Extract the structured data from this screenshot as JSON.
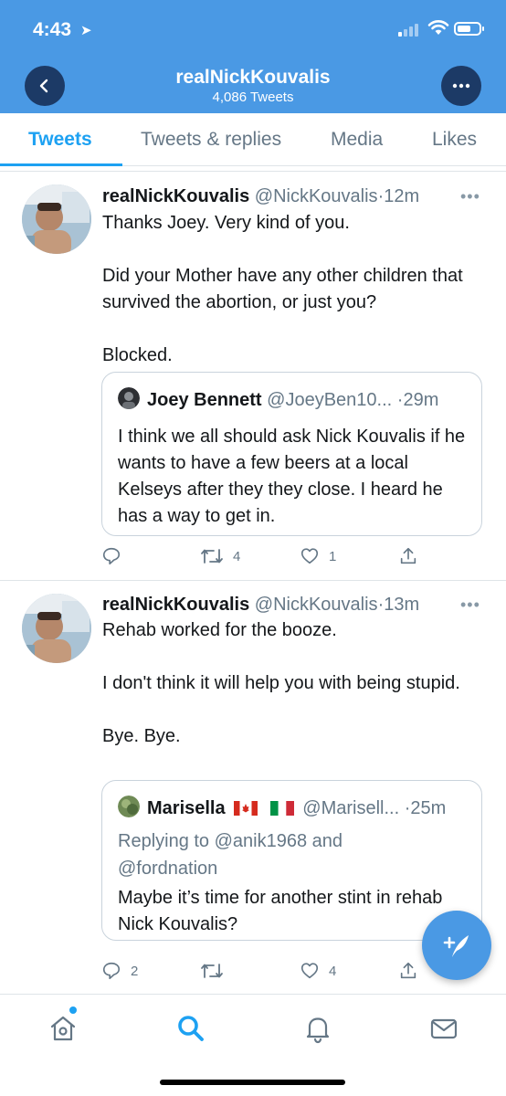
{
  "status_bar": {
    "time": "4:43"
  },
  "header": {
    "name": "realNickKouvalis",
    "tweet_count": "4,086 Tweets",
    "back_icon": "chevron-left-icon",
    "more_icon": "more-horizontal-icon",
    "background": "#4a99e4"
  },
  "tabs": [
    {
      "label": "Tweets",
      "active": true
    },
    {
      "label": "Tweets & replies",
      "active": false
    },
    {
      "label": "Media",
      "active": false
    },
    {
      "label": "Likes",
      "active": false
    }
  ],
  "tweets": [
    {
      "name": "realNickKouvalis",
      "handle": "@NickKouvalis",
      "separator": "·",
      "time": "12m",
      "caret": "•••",
      "text": "Thanks Joey. Very kind of you.\n\nDid your Mother have any other children that survived the abortion, or just you?\n\nBlocked.",
      "quote": {
        "name": "Joey Bennett",
        "handle": "@JoeyBen10...",
        "separator": "·",
        "time": "29m",
        "text": "I think we all should ask Nick Kouvalis if he wants to have a few beers at a local Kelseys after they they close. I heard he has a way to get in."
      },
      "actions": {
        "replies": "",
        "retweets": "4",
        "likes": "1"
      }
    },
    {
      "name": "realNickKouvalis",
      "handle": "@NickKouvalis",
      "separator": "·",
      "time": "13m",
      "caret": "•••",
      "text": "Rehab worked for the booze.\n\nI don't think it will help you with being stupid.\n\nBye. Bye.",
      "quote": {
        "name": "Marisella",
        "handle": "@Marisell...",
        "separator": "·",
        "time": "25m",
        "reply_to": "Replying to @anik1968 and\n@fordnation",
        "text": "Maybe it’s time for another stint in rehab Nick Kouvalis?"
      },
      "actions": {
        "replies": "2",
        "retweets": "",
        "likes": "4"
      }
    }
  ],
  "fab": {
    "icon": "compose-tweet-icon",
    "color": "#4a99e4"
  },
  "bottom_nav": [
    {
      "icon": "home-icon"
    },
    {
      "icon": "search-icon"
    },
    {
      "icon": "notifications-bell-icon"
    },
    {
      "icon": "messages-envelope-icon"
    }
  ],
  "accent_color": "#1da1f2"
}
